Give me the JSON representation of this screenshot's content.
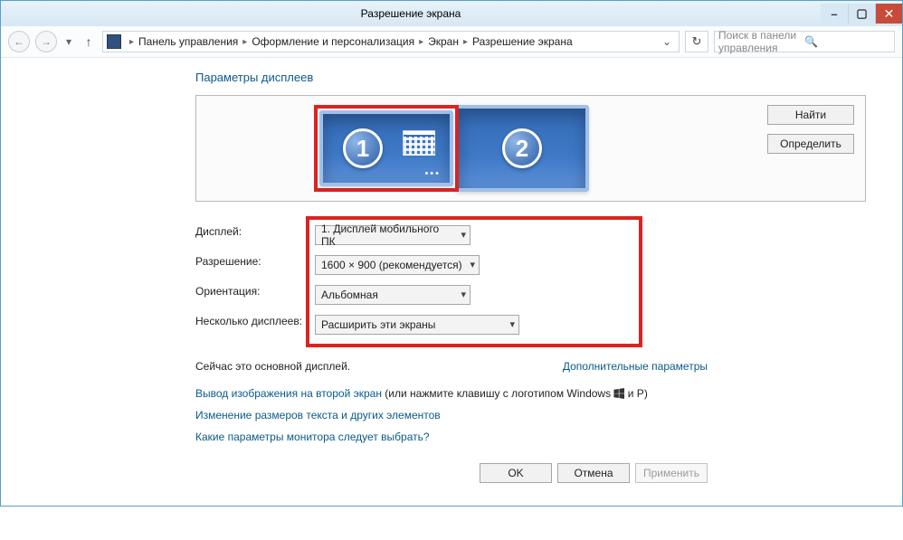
{
  "window": {
    "title": "Разрешение экрана"
  },
  "breadcrumb": {
    "items": [
      "Панель управления",
      "Оформление и персонализация",
      "Экран",
      "Разрешение экрана"
    ]
  },
  "search": {
    "placeholder": "Поиск в панели управления"
  },
  "page": {
    "heading": "Параметры дисплеев"
  },
  "preview": {
    "find": "Найти",
    "identify": "Определить",
    "mon1": "1",
    "mon2": "2"
  },
  "fields": {
    "display_label": "Дисплей:",
    "display_value": "1. Дисплей мобильного ПК",
    "resolution_label": "Разрешение:",
    "resolution_value": "1600 × 900 (рекомендуется)",
    "orientation_label": "Ориентация:",
    "orientation_value": "Альбомная",
    "multi_label": "Несколько дисплеев:",
    "multi_value": "Расширить эти экраны"
  },
  "status": {
    "primary": "Сейчас это основной дисплей.",
    "advanced": "Дополнительные параметры"
  },
  "links": {
    "project_prefix": "Вывод изображения на второй экран",
    "project_suffix": " (или нажмите клавишу с логотипом Windows ",
    "project_tail": " и P)",
    "textsize": "Изменение размеров текста и других элементов",
    "which": "Какие параметры монитора следует выбрать?"
  },
  "buttons": {
    "ok": "OK",
    "cancel": "Отмена",
    "apply": "Применить"
  }
}
